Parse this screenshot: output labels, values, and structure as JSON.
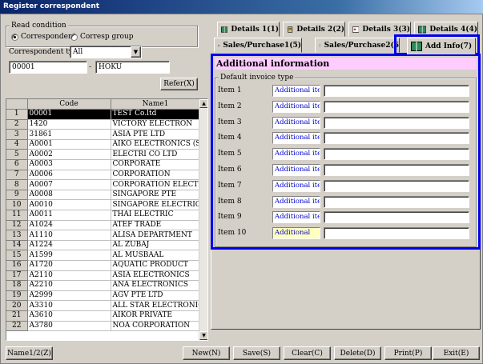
{
  "window": {
    "title": "Register correspondent"
  },
  "read_condition": {
    "legend": "Read condition",
    "radio_correspondent": "Correspondent",
    "radio_group": "Corresp group",
    "type_label": "Correspondent type",
    "type_value": "All",
    "code_from": "00001",
    "dash": "-",
    "code_to": "HOKU",
    "refer_button": "Refer(X)"
  },
  "grid": {
    "headers": {
      "code": "Code",
      "name": "Name1"
    },
    "rows": [
      {
        "n": "1",
        "code": "00001",
        "name": "TEST Co.ltd"
      },
      {
        "n": "2",
        "code": "1420",
        "name": "VICTORY ELECTRON"
      },
      {
        "n": "3",
        "code": "31861",
        "name": "ASIA PTE LTD"
      },
      {
        "n": "4",
        "code": "A0001",
        "name": "AIKO ELECTRONICS (S)"
      },
      {
        "n": "5",
        "code": "A0002",
        "name": "ELECTRI CO LTD"
      },
      {
        "n": "6",
        "code": "A0003",
        "name": "CORPORATE"
      },
      {
        "n": "7",
        "code": "A0006",
        "name": "CORPORATION"
      },
      {
        "n": "8",
        "code": "A0007",
        "name": "CORPORATION ELECTRIC"
      },
      {
        "n": "9",
        "code": "A0008",
        "name": "SINGAPORE PTE"
      },
      {
        "n": "10",
        "code": "A0010",
        "name": "SINGAPORE ELECTRIC"
      },
      {
        "n": "11",
        "code": "A0011",
        "name": "THAI ELECTRIC"
      },
      {
        "n": "12",
        "code": "A1024",
        "name": "ATEF TRADE"
      },
      {
        "n": "13",
        "code": "A1110",
        "name": "ALISA   DEPARTMENT"
      },
      {
        "n": "14",
        "code": "A1224",
        "name": "AL ZUBAJ"
      },
      {
        "n": "15",
        "code": "A1599",
        "name": "AL MUSBAAL"
      },
      {
        "n": "16",
        "code": "A1720",
        "name": "AQUATIC PRODUCT"
      },
      {
        "n": "17",
        "code": "A2110",
        "name": "ASIA ELECTRONICS"
      },
      {
        "n": "18",
        "code": "A2210",
        "name": "ANA ELECTRONICS"
      },
      {
        "n": "19",
        "code": "A2999",
        "name": "AGV PTE LTD"
      },
      {
        "n": "20",
        "code": "A3310",
        "name": "ALL STAR ELECTRONIC"
      },
      {
        "n": "21",
        "code": "A3610",
        "name": "AIKOR PRIVATE"
      },
      {
        "n": "22",
        "code": "A3780",
        "name": "NOA CORPORATION"
      }
    ]
  },
  "tabs": {
    "details1": "Details 1(1)",
    "details2": "Details 2(2)",
    "details3": "Details 3(3)",
    "details4": "Details 4(4)",
    "sales1": "Sales/Purchase1(5)",
    "sales2": "Sales/Purchase2(6",
    "addinfo": "Add Info(7)"
  },
  "panel": {
    "title": "Additional information",
    "group_legend": "Default invoice type",
    "items": [
      {
        "label": "Item 1",
        "tag": "Additional item1",
        "value": ""
      },
      {
        "label": "Item 2",
        "tag": "Additional item2",
        "value": ""
      },
      {
        "label": "Item 3",
        "tag": "Additional item3",
        "value": ""
      },
      {
        "label": "Item 4",
        "tag": "Additional item4",
        "value": ""
      },
      {
        "label": "Item 5",
        "tag": "Additional item5",
        "value": ""
      },
      {
        "label": "Item 6",
        "tag": "Additional item6",
        "value": ""
      },
      {
        "label": "Item 7",
        "tag": "Additional item7",
        "value": ""
      },
      {
        "label": "Item 8",
        "tag": "Additional item8",
        "value": ""
      },
      {
        "label": "Item 9",
        "tag": "Additional item9",
        "value": ""
      },
      {
        "label": "Item 10",
        "tag": "Additional",
        "value": ""
      }
    ]
  },
  "buttons": {
    "name12": "Name1/2(Z)",
    "new": "New(N)",
    "save": "Save(S)",
    "clear": "Clear(C)",
    "delete": "Delete(D)",
    "print": "Print(P)",
    "exit": "Exit(E)"
  },
  "colors": {
    "title_bar": "#0a246a",
    "highlight": "#0000ee",
    "panel_title": "#ffccff",
    "tag_text": "#0000cc"
  }
}
